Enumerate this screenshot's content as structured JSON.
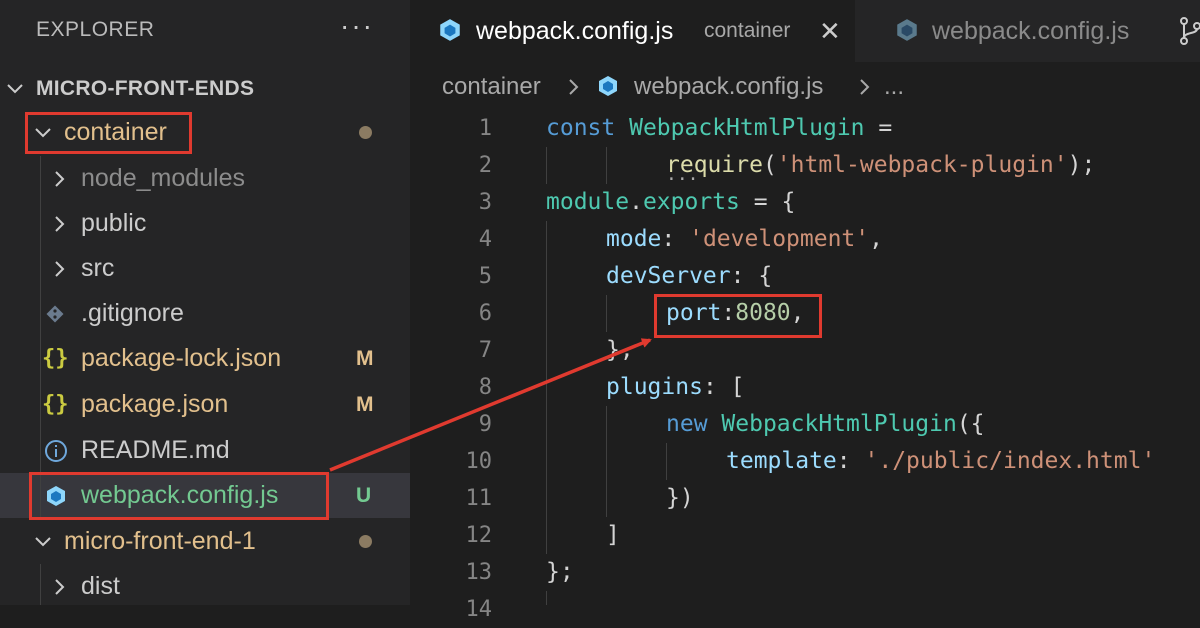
{
  "sidebar": {
    "title": "EXPLORER",
    "more": "···",
    "root": "MICRO-FRONT-ENDS",
    "items": [
      {
        "label": "container",
        "status": ""
      },
      {
        "label": "node_modules",
        "status": ""
      },
      {
        "label": "public",
        "status": ""
      },
      {
        "label": "src",
        "status": ""
      },
      {
        "label": ".gitignore",
        "status": ""
      },
      {
        "label": "package-lock.json",
        "status": "M"
      },
      {
        "label": "package.json",
        "status": "M"
      },
      {
        "label": "README.md",
        "status": ""
      },
      {
        "label": "webpack.config.js",
        "status": "U"
      },
      {
        "label": "micro-front-end-1",
        "status": ""
      },
      {
        "label": "dist",
        "status": ""
      }
    ]
  },
  "tabs": [
    {
      "name": "webpack.config.js",
      "desc": "container",
      "close": "✕"
    },
    {
      "name": "webpack.config.js",
      "desc": ""
    }
  ],
  "breadcrumb": {
    "folder": "container",
    "file": "webpack.config.js",
    "more": "..."
  },
  "code": {
    "line_numbers": [
      "1",
      "2",
      "3",
      "4",
      "5",
      "6",
      "7",
      "8",
      "9",
      "10",
      "11",
      "12",
      "13",
      "14"
    ],
    "l1": {
      "a": "const",
      "b": "WebpackHtmlPlugin",
      "c": "="
    },
    "l2": {
      "a": "require",
      "b": "(",
      "c": "'html-webpack-plugin'",
      "d": ");",
      "dots": "..."
    },
    "l3": {
      "a": "module",
      "b": ".",
      "c": "exports",
      "d": "= {"
    },
    "l4": {
      "a": "mode",
      "b": ":",
      "c": "'development'",
      "d": ","
    },
    "l5": {
      "a": "devServer",
      "b": ": {"
    },
    "l6": {
      "a": "port",
      "b": ":",
      "c": "8080",
      "d": ","
    },
    "l7": {
      "a": "},"
    },
    "l8": {
      "a": "plugins",
      "b": ": ["
    },
    "l9": {
      "a": "new",
      "b": "WebpackHtmlPlugin",
      "c": "({"
    },
    "l10": {
      "a": "template",
      "b": ":",
      "c": "'./public/index.html'"
    },
    "l11": {
      "a": "})"
    },
    "l12": {
      "a": "]"
    },
    "l13": {
      "a": "};"
    }
  },
  "colors": {
    "highlight": "#e03a2f",
    "modified": "#e2c08d",
    "untracked": "#73c991",
    "keyword": "#569cd6",
    "type": "#4ec9b0",
    "string": "#ce9178"
  }
}
